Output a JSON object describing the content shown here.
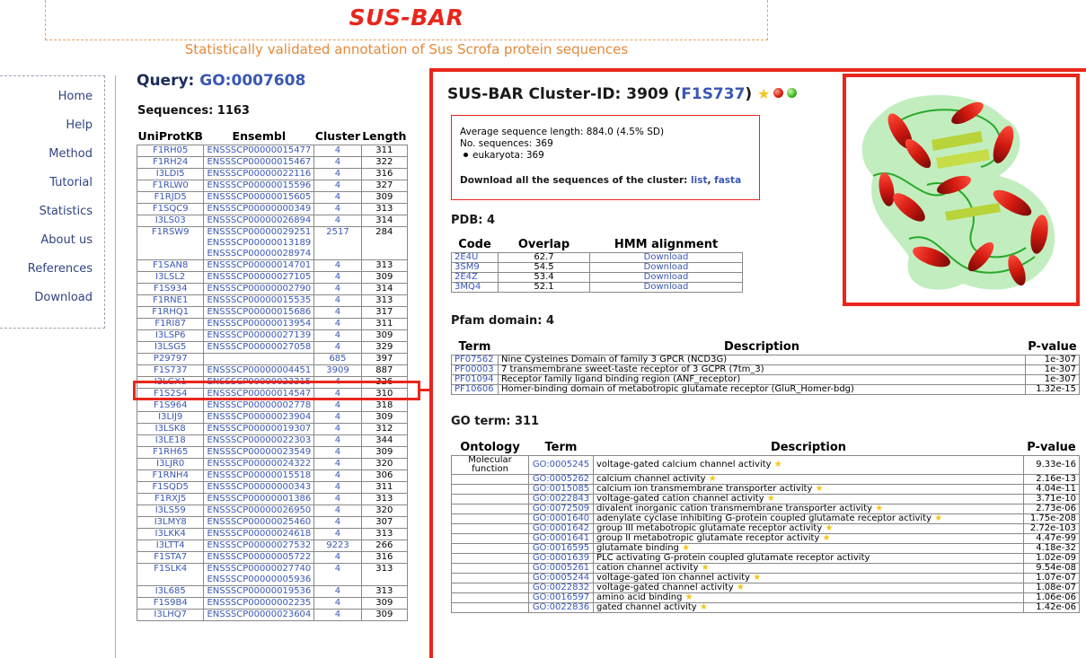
{
  "header": {
    "logo": "SUS-BAR",
    "subtitle": "Statistically validated annotation of Sus Scrofa protein sequences"
  },
  "nav": [
    "Home",
    "Help",
    "Method",
    "Tutorial",
    "Statistics",
    "About us",
    "References",
    "Download"
  ],
  "query": {
    "label": "Query: ",
    "go": "GO:0007608",
    "sequences": "Sequences: 1163",
    "headers": [
      "UniProtKB",
      "Ensembl",
      "Cluster",
      "Length"
    ],
    "rows": [
      [
        "F1RH05",
        "ENSSSCP00000015477",
        "4",
        "311"
      ],
      [
        "F1RH24",
        "ENSSSCP00000015467",
        "4",
        "322"
      ],
      [
        "I3LDI5",
        "ENSSSCP00000022116",
        "4",
        "316"
      ],
      [
        "F1RLW0",
        "ENSSSCP00000015596",
        "4",
        "327"
      ],
      [
        "F1RJD5",
        "ENSSSCP00000015605",
        "4",
        "309"
      ],
      [
        "F1SQC9",
        "ENSSSCP00000000349",
        "4",
        "313"
      ],
      [
        "I3LS03",
        "ENSSSCP00000026894",
        "4",
        "314"
      ],
      [
        "F1RSW9",
        "ENSSSCP00000029251\nENSSSCP00000013189\nENSSSCP00000028974",
        "2517",
        "284"
      ],
      [
        "F1SAN8",
        "ENSSSCP00000014701",
        "4",
        "313"
      ],
      [
        "I3LSL2",
        "ENSSSCP00000027105",
        "4",
        "309"
      ],
      [
        "F1S934",
        "ENSSSCP00000002790",
        "4",
        "314"
      ],
      [
        "F1RNE1",
        "ENSSSCP00000015535",
        "4",
        "313"
      ],
      [
        "F1RHQ1",
        "ENSSSCP00000015686",
        "4",
        "317"
      ],
      [
        "F1RI87",
        "ENSSSCP00000013954",
        "4",
        "311"
      ],
      [
        "I3LSP6",
        "ENSSSCP00000027139",
        "4",
        "309"
      ],
      [
        "I3LSG5",
        "ENSSSCP00000027058",
        "4",
        "329"
      ],
      [
        "P29797",
        "",
        "685",
        "397"
      ],
      [
        "F1S737",
        "ENSSSCP00000004451",
        "3909",
        "887"
      ],
      [
        "I3LGX1",
        "ENSSSCP00000023315",
        "4",
        "326"
      ],
      [
        "F1S2S4",
        "ENSSSCP00000014547",
        "4",
        "310"
      ],
      [
        "F1S964",
        "ENSSSCP00000002778",
        "4",
        "318"
      ],
      [
        "I3LIJ9",
        "ENSSSCP00000023904",
        "4",
        "309"
      ],
      [
        "I3LSK8",
        "ENSSSCP00000019307",
        "4",
        "312"
      ],
      [
        "I3LE18",
        "ENSSSCP00000022303",
        "4",
        "344"
      ],
      [
        "F1RH65",
        "ENSSSCP00000023549",
        "4",
        "309"
      ],
      [
        "I3LJR0",
        "ENSSSCP00000024322",
        "4",
        "320"
      ],
      [
        "F1RNH4",
        "ENSSSCP00000015518",
        "4",
        "306"
      ],
      [
        "F1SQD5",
        "ENSSSCP00000000343",
        "4",
        "311"
      ],
      [
        "F1RXJ5",
        "ENSSSCP00000001386",
        "4",
        "313"
      ],
      [
        "I3LS59",
        "ENSSSCP00000026950",
        "4",
        "320"
      ],
      [
        "I3LMY8",
        "ENSSSCP00000025460",
        "4",
        "307"
      ],
      [
        "I3LKK4",
        "ENSSSCP00000024618",
        "4",
        "313"
      ],
      [
        "I3LTT4",
        "ENSSSCP00000027532",
        "9223",
        "266"
      ],
      [
        "F1STA7",
        "ENSSSCP00000005722",
        "4",
        "316"
      ],
      [
        "F1SLK4",
        "ENSSSCP00000027740\nENSSSCP00000005936",
        "4",
        "313"
      ],
      [
        "I3L685",
        "ENSSSCP00000019536",
        "4",
        "313"
      ],
      [
        "F1S9B4",
        "ENSSSCP00000002235",
        "4",
        "309"
      ],
      [
        "I3LHQ7",
        "ENSSSCP00000023604",
        "4",
        "309"
      ]
    ]
  },
  "cluster": {
    "title": "SUS-BAR Cluster-ID: 3909 (",
    "title_id": "F1S737",
    "title_end": ")",
    "avg": "Average sequence length: 884.0 (4.5% SD)",
    "nseq": "No. sequences: 369",
    "euk": "eukaryota: 369",
    "dl_label": "Download all the sequences of the cluster: ",
    "dl_list": "list",
    "dl_sep": ", ",
    "dl_fasta": "fasta"
  },
  "pdb": {
    "heading": "PDB: 4",
    "headers": [
      "Code",
      "Overlap",
      "HMM alignment"
    ],
    "rows": [
      [
        "2E4U",
        "62.7",
        "Download"
      ],
      [
        "3SM9",
        "54.5",
        "Download"
      ],
      [
        "2E4Z",
        "53.4",
        "Download"
      ],
      [
        "3MQ4",
        "52.1",
        "Download"
      ]
    ]
  },
  "pfam": {
    "heading": "Pfam domain: 4",
    "headers": [
      "Term",
      "Description",
      "P-value"
    ],
    "rows": [
      [
        "PF07562",
        "Nine Cysteines Domain of family 3 GPCR (NCD3G)",
        "1e-307"
      ],
      [
        "PF00003",
        "7 transmembrane sweet-taste receptor of 3 GCPR (7tm_3)",
        "1e-307"
      ],
      [
        "PF01094",
        "Receptor family ligand binding region (ANF_receptor)",
        "1e-307"
      ],
      [
        "PF10606",
        "Homer-binding domain of metabotropic glutamate receptor (GluR_Homer-bdg)",
        "1.32e-15"
      ]
    ]
  },
  "go": {
    "heading": "GO term: 311",
    "headers": [
      "Ontology",
      "Term",
      "Description",
      "P-value"
    ],
    "ontology": "Molecular function",
    "rows": [
      [
        "GO:0005245",
        "voltage-gated calcium channel activity",
        "9.33e-16"
      ],
      [
        "GO:0005262",
        "calcium channel activity",
        "2.16e-13"
      ],
      [
        "GO:0015085",
        "calcium ion transmembrane transporter activity",
        "4.04e-11"
      ],
      [
        "GO:0022843",
        "voltage-gated cation channel activity",
        "3.71e-10"
      ],
      [
        "GO:0072509",
        "divalent inorganic cation transmembrane transporter activity",
        "2.73e-06"
      ],
      [
        "GO:0001640",
        "adenylate cyclase inhibiting G-protein coupled glutamate receptor activity",
        "1.75e-208"
      ],
      [
        "GO:0001642",
        "group III metabotropic glutamate receptor activity",
        "2.72e-103"
      ],
      [
        "GO:0001641",
        "group II metabotropic glutamate receptor activity",
        "4.47e-99"
      ],
      [
        "GO:0016595",
        "glutamate binding",
        "4.18e-32"
      ],
      [
        "GO:0001639",
        "PLC activating G-protein coupled glutamate receptor activity",
        "1.02e-09"
      ],
      [
        "GO:0005261",
        "cation channel activity",
        "9.54e-08"
      ],
      [
        "GO:0005244",
        "voltage-gated ion channel activity",
        "1.07e-07"
      ],
      [
        "GO:0022832",
        "voltage-gated channel activity",
        "1.08e-07"
      ],
      [
        "GO:0016597",
        "amino acid binding",
        "1.06e-06"
      ],
      [
        "GO:0022836",
        "gated channel activity",
        "1.42e-06"
      ]
    ],
    "starred": [
      true,
      true,
      true,
      true,
      true,
      true,
      true,
      true,
      true,
      false,
      true,
      true,
      true,
      true,
      true
    ]
  },
  "colors": {
    "accent": "#e8261c",
    "link": "#3a57b5",
    "star": "#f5c518"
  },
  "icons": [
    "star-icon",
    "red-dot-icon",
    "green-dot-icon",
    "protein-structure-image"
  ]
}
